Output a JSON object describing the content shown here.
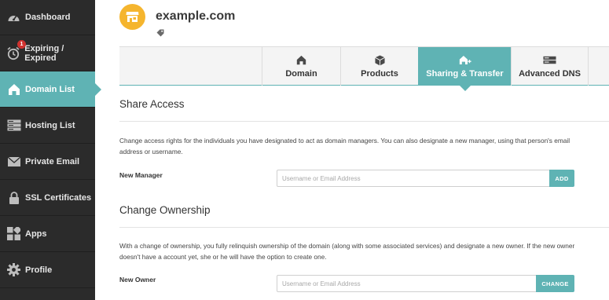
{
  "sidebar": {
    "items": [
      {
        "label": "Dashboard",
        "icon": "speedometer-icon"
      },
      {
        "label": "Expiring / Expired",
        "icon": "alarm-clock-icon",
        "badge": "1"
      },
      {
        "label": "Domain List",
        "icon": "home-icon",
        "active": true
      },
      {
        "label": "Hosting List",
        "icon": "server-icon"
      },
      {
        "label": "Private Email",
        "icon": "envelope-icon"
      },
      {
        "label": "SSL Certificates",
        "icon": "lock-icon"
      },
      {
        "label": "Apps",
        "icon": "apps-grid-icon"
      },
      {
        "label": "Profile",
        "icon": "gear-icon"
      }
    ]
  },
  "header": {
    "domain": "example.com",
    "logo_icon": "storefront-icon",
    "tag_icon": "tag-icon"
  },
  "tabs": [
    {
      "label": "Domain",
      "icon": "home-icon"
    },
    {
      "label": "Products",
      "icon": "box-icon"
    },
    {
      "label": "Sharing & Transfer",
      "icon": "home-share-icon",
      "active": true
    },
    {
      "label": "Advanced DNS",
      "icon": "dns-server-icon"
    }
  ],
  "share_access": {
    "heading": "Share Access",
    "description": "Change access rights for the individuals you have designated to act as domain managers. You can also designate a new manager, using that person's email address or username.",
    "field_label": "New Manager",
    "placeholder": "Username or Email Address",
    "value": "",
    "button": "ADD"
  },
  "change_ownership": {
    "heading": "Change Ownership",
    "description": "With a change of ownership, you fully relinquish ownership of the domain (along with some associated services) and designate a new owner. If the new owner doesn't have a account yet, she or he will have the option to create one.",
    "field_label": "New Owner",
    "placeholder": "Username or Email Address",
    "value": "",
    "button": "CHANGE"
  },
  "colors": {
    "accent": "#5fb3b4",
    "sidebar_bg": "#2b2b2b",
    "badge": "#d0322f",
    "logo_bg": "#f5b52e"
  }
}
